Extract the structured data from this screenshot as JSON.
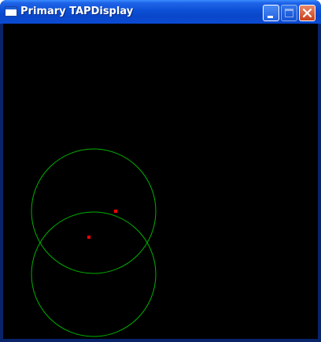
{
  "window": {
    "title": "Primary TAPDisplay",
    "icon": "window-app-icon"
  },
  "controls": {
    "minimize": "minimize-icon",
    "maximize": "maximize-icon",
    "close": "close-icon"
  },
  "display": {
    "background": "#000000",
    "circle_color": "#00b000",
    "point_color": "#ff0000"
  }
}
